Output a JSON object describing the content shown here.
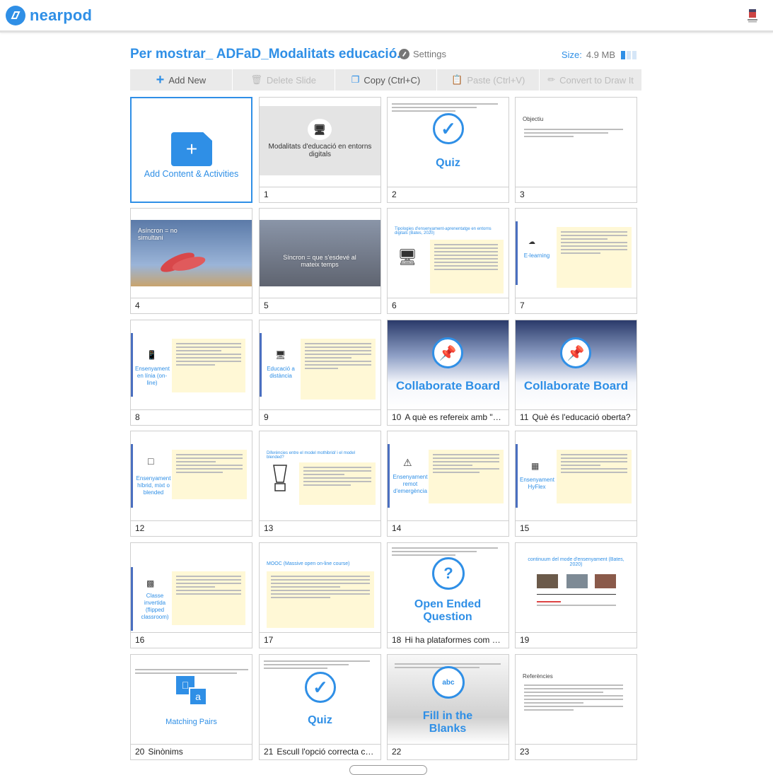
{
  "app": {
    "logo_text": "nearpod",
    "brand_color": "#2f8fe6"
  },
  "header": {
    "title": "Per mostrar_ ADFaD_Modalitats educació...",
    "settings_label": "Settings",
    "size_label": "Size:",
    "size_value": "4.9 MB"
  },
  "toolbar": {
    "add_new": "Add New",
    "delete_slide": "Delete Slide",
    "copy": "Copy (Ctrl+C)",
    "paste": "Paste (Ctrl+V)",
    "convert": "Convert to Draw It"
  },
  "add_content": {
    "label": "Add Content & Activities"
  },
  "slides": [
    {
      "num": "1",
      "caption": "",
      "thumb_text": "Modalitats d'educació en entorns digitals"
    },
    {
      "num": "2",
      "caption": "",
      "thumb_text": "Quiz"
    },
    {
      "num": "3",
      "caption": "",
      "thumb_text": "Objectiu"
    },
    {
      "num": "4",
      "caption": "",
      "thumb_text": "Asíncron = no simultani"
    },
    {
      "num": "5",
      "caption": "",
      "thumb_text": "Síncron = que s'esdevé al mateix temps"
    },
    {
      "num": "6",
      "caption": "",
      "thumb_text": "Tipologies d'ensenyament-aprenentatge en entorns digitals (Bates, 2020)"
    },
    {
      "num": "7",
      "caption": "",
      "thumb_text": "E-learning"
    },
    {
      "num": "8",
      "caption": "",
      "thumb_text": "Ensenyament en línia (on-line)"
    },
    {
      "num": "9",
      "caption": "",
      "thumb_text": "Educació a distància"
    },
    {
      "num": "10",
      "caption": "A què es refereix amb \"dist...",
      "thumb_text": "Collaborate Board"
    },
    {
      "num": "11",
      "caption": "Què és l'educació oberta?",
      "thumb_text": "Collaborate Board"
    },
    {
      "num": "12",
      "caption": "",
      "thumb_text": "Ensenyament híbrid, mixt o blended"
    },
    {
      "num": "13",
      "caption": "",
      "thumb_text": "Diferències entre el model mothibrid/ i el model blended?"
    },
    {
      "num": "14",
      "caption": "",
      "thumb_text": "Ensenyament remot d'emergència"
    },
    {
      "num": "15",
      "caption": "",
      "thumb_text": "Ensenyament HyFlex"
    },
    {
      "num": "16",
      "caption": "",
      "thumb_text": "Classe invertida (flipped classroom)"
    },
    {
      "num": "17",
      "caption": "",
      "thumb_text": "MOOC (Massive open on-line course)"
    },
    {
      "num": "18",
      "caption": "Hi ha plataformes com Co...",
      "thumb_text": "Open Ended Question"
    },
    {
      "num": "19",
      "caption": "",
      "thumb_text": "continuum del mode d'ensenyament (Bates, 2020)"
    },
    {
      "num": "20",
      "caption": "Sinònims",
      "thumb_text": "Matching Pairs"
    },
    {
      "num": "21",
      "caption": "Escull l'opció correcta corr...",
      "thumb_text": "Quiz"
    },
    {
      "num": "22",
      "caption": "",
      "thumb_text": "Fill in the Blanks"
    },
    {
      "num": "23",
      "caption": "",
      "thumb_text": "Referències"
    }
  ]
}
